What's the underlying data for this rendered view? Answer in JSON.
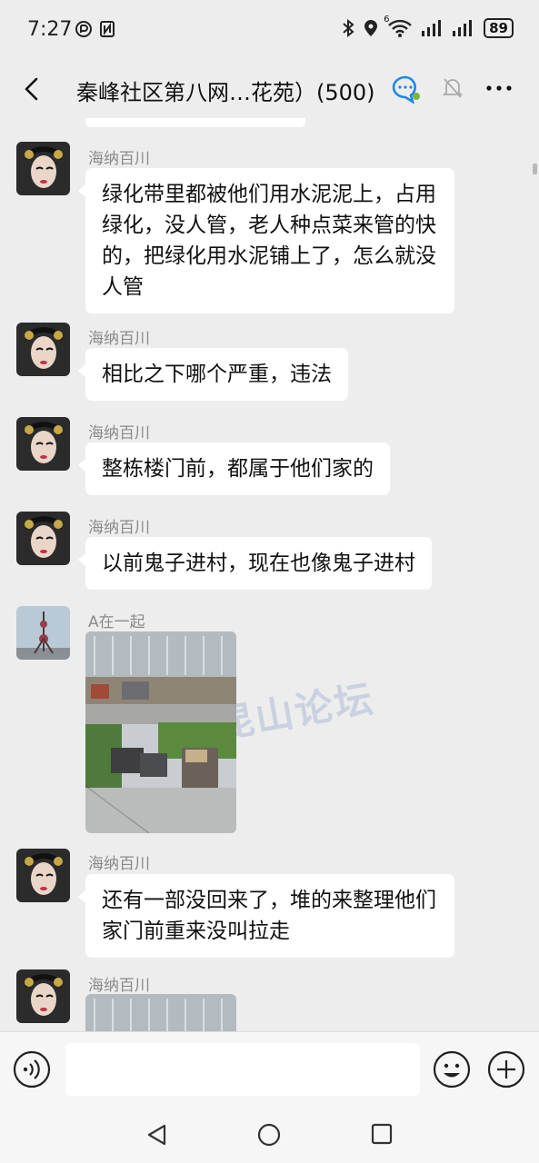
{
  "status_bar": {
    "time": "7:27",
    "network": "6",
    "battery": "89"
  },
  "header": {
    "title": "秦峰社区第八网…花苑）(500)",
    "icons": [
      "back-icon",
      "chat-bubble-icon",
      "mute-bell-icon",
      "more-icon"
    ]
  },
  "watermark_text": "昆山论坛",
  "messages": [
    {
      "sender": "海纳百川",
      "text": "绿化带里都被他们用水泥泥上，占用绿化，没人管，老人种点菜来管的快的，把绿化用水泥铺上了，怎么就没人管"
    },
    {
      "sender": "海纳百川",
      "text": "相比之下哪个严重，违法"
    },
    {
      "sender": "海纳百川",
      "text": "整栋楼门前，都属于他们家的"
    },
    {
      "sender": "海纳百川",
      "text": "以前鬼子进村，现在也像鬼子进村"
    },
    {
      "sender": "A在一起",
      "text": ""
    },
    {
      "sender": "海纳百川",
      "text": "还有一部没回来了，堆的来整理他们家门前重来没叫拉走"
    },
    {
      "sender": "海纳百川",
      "text": ""
    }
  ],
  "input_bar": {
    "placeholder": "",
    "icons": [
      "voice-icon",
      "emoji-icon",
      "plus-icon"
    ]
  },
  "nav_bar": {
    "icons": [
      "nav-back-icon",
      "nav-home-icon",
      "nav-recent-icon"
    ]
  }
}
